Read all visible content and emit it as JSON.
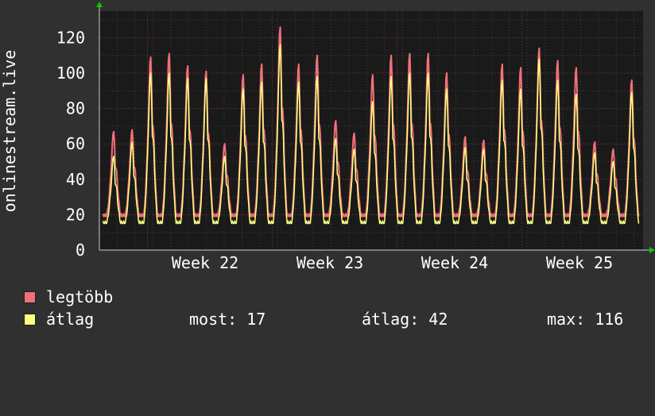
{
  "colors": {
    "background": "#303030",
    "plot_background": "#1a1a1a",
    "grid": "#444444",
    "grid_major": "#7a3a3a",
    "axis_arrow": "#00cc00",
    "series_max": "#f0707a",
    "series_avg": "#ffff80"
  },
  "chart_data": {
    "type": "line",
    "ylabel": "onlinestream.live",
    "ylim": [
      0,
      135
    ],
    "yticks": [
      "0",
      "20",
      "40",
      "60",
      "80",
      "100",
      "120"
    ],
    "xticks": [
      "Week 22",
      "Week 23",
      "Week 24",
      "Week 25"
    ],
    "xrange_days": [
      0,
      30.5
    ],
    "xtick_days": [
      6.2,
      13.2,
      20.2,
      27.2
    ],
    "grid": true,
    "series": [
      {
        "name": "legtöbb",
        "color": "#f0707a",
        "daily_peaks": [
          67,
          68,
          109,
          111,
          104,
          101,
          60,
          99,
          105,
          126,
          105,
          110,
          73,
          66,
          99,
          110,
          111,
          111,
          100,
          64,
          62,
          105,
          103,
          114,
          107,
          103,
          61,
          57,
          96
        ],
        "trough": 19
      },
      {
        "name": "átlag",
        "color": "#ffff80",
        "daily_peaks": [
          53,
          61,
          100,
          100,
          97,
          97,
          53,
          91,
          95,
          116,
          95,
          98,
          63,
          57,
          84,
          98,
          100,
          100,
          91,
          58,
          57,
          96,
          91,
          108,
          96,
          88,
          55,
          50,
          89
        ],
        "trough": 15
      }
    ]
  },
  "legend": {
    "max_label": "legtöbb",
    "avg_label": "átlag",
    "now_text": "most: 17",
    "avg_text": "átlag: 42",
    "max_text": "max: 116"
  }
}
